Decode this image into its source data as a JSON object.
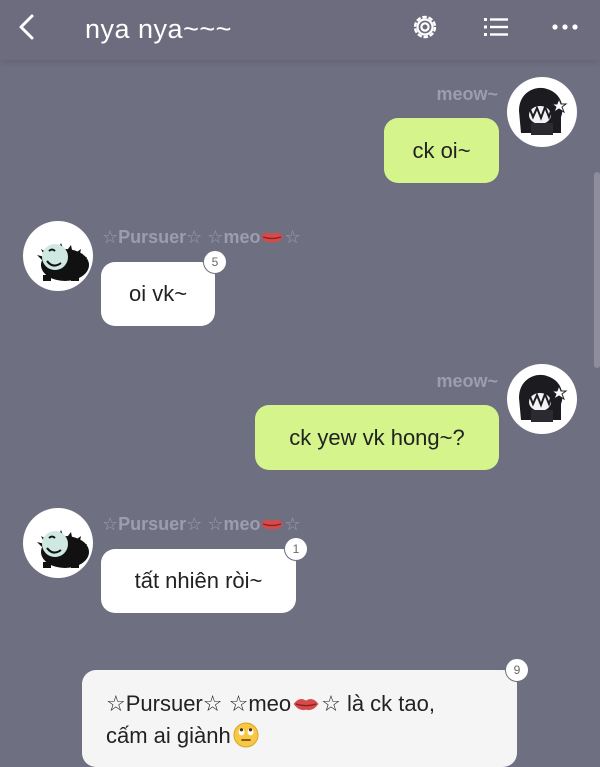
{
  "header": {
    "title": "nya nya~~~",
    "back_icon": "chevron-left-icon",
    "settings_icon": "gear-icon",
    "list_icon": "list-icon",
    "more_icon": "more-horizontal-icon"
  },
  "messages": [
    {
      "sender": "meow~",
      "side": "right",
      "text": "ck oi~"
    },
    {
      "sender": "☆Pursuer☆ ☆meo",
      "sender_suffix": "☆",
      "side": "left",
      "text": "oi vk~",
      "count": "5"
    },
    {
      "sender": "meow~",
      "side": "right",
      "text": "ck yew vk hong~?"
    },
    {
      "sender": "☆Pursuer☆ ☆meo",
      "sender_suffix": "☆",
      "side": "left",
      "text": "tất nhiên ròi~",
      "count": "1"
    },
    {
      "line1_prefix": "☆Pursuer☆ ☆meo",
      "line1_suffix": "☆ là ck tao,",
      "line2": "cấm ai giành",
      "count": "9"
    }
  ],
  "colors": {
    "background": "#6f6f82",
    "my_bubble": "#d5f58c",
    "their_bubble": "#ffffff",
    "sender_name": "#9d9db0"
  }
}
